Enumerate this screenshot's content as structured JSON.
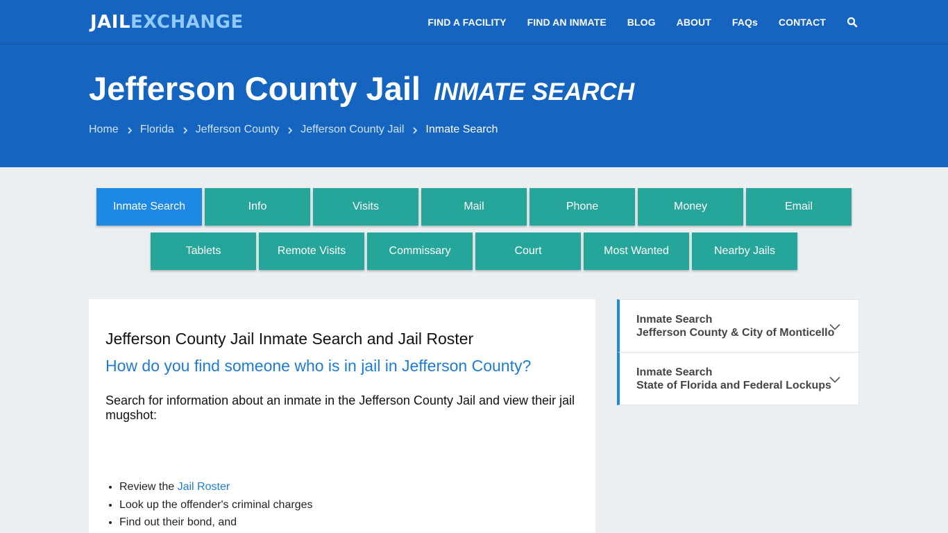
{
  "logo": {
    "part1": "JAIL",
    "part2": "EXCHANGE"
  },
  "nav": [
    "FIND A FACILITY",
    "FIND AN INMATE",
    "BLOG",
    "ABOUT",
    "FAQs",
    "CONTACT"
  ],
  "hero": {
    "title": "Jefferson County Jail",
    "subtitle": "INMATE SEARCH",
    "breadcrumb": [
      "Home",
      "Florida",
      "Jefferson County",
      "Jefferson County Jail"
    ],
    "breadcrumb_current": "Inmate Search"
  },
  "tabs": {
    "row1": [
      "Inmate Search",
      "Info",
      "Visits",
      "Mail",
      "Phone",
      "Money",
      "Email"
    ],
    "row2": [
      "Tablets",
      "Remote Visits",
      "Commissary",
      "Court",
      "Most Wanted",
      "Nearby Jails"
    ]
  },
  "main": {
    "heading": "Jefferson County Jail Inmate Search and Jail Roster",
    "question": "How do you find someone who is in jail in Jefferson County?",
    "lead": "Search for information about an inmate in the Jefferson County Jail and view their jail mugshot:",
    "list": {
      "item1_prefix": "Review the ",
      "item1_link": "Jail Roster",
      "item2": "Look up the offender's criminal charges",
      "item3": "Find out their bond, and"
    }
  },
  "sidebar": [
    {
      "line1": "Inmate Search",
      "line2": "Jefferson County & City of Monticello"
    },
    {
      "line1": "Inmate Search",
      "line2": "State of Florida and Federal Lockups"
    }
  ],
  "colors": {
    "primary": "#1565c0",
    "tab": "#26a69a",
    "tab_active": "#1e88e5",
    "link": "#1e7bd3",
    "background": "#eceff1"
  },
  "icons": {
    "search": "search-icon",
    "breadcrumb_separator": "chevron-right-icon",
    "accordion": "chevron-down-icon"
  }
}
